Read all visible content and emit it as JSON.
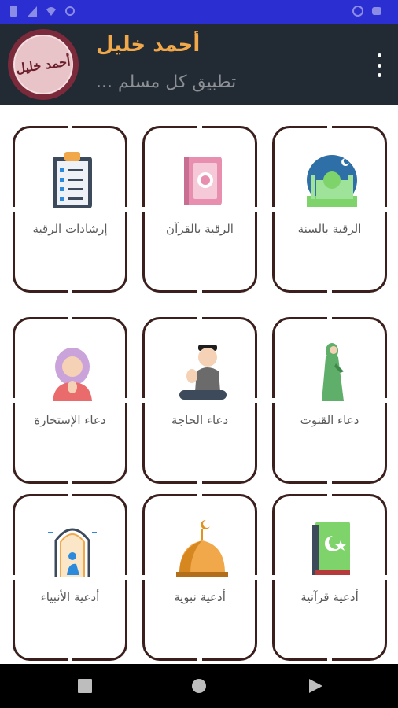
{
  "header": {
    "logo_text": "أحمد خليل",
    "title": "أحمد خليل",
    "subtitle": "تطبيق كل مسلم ..."
  },
  "grid": {
    "items": [
      {
        "label": "إرشادات الرقية",
        "icon": "clipboard-checklist-icon"
      },
      {
        "label": "الرقية بالقرآن",
        "icon": "quran-book-icon"
      },
      {
        "label": "الرقية بالسنة",
        "icon": "mosque-icon"
      },
      {
        "label": "دعاء الإستخارة",
        "icon": "praying-girl-icon"
      },
      {
        "label": "دعاء الحاجة",
        "icon": "praying-boy-icon"
      },
      {
        "label": "دعاء القنوت",
        "icon": "praying-woman-icon"
      },
      {
        "label": "أدعية الأنبياء",
        "icon": "prophets-prayer-icon"
      },
      {
        "label": "أدعية نبوية",
        "icon": "mosque-dome-icon"
      },
      {
        "label": "أدعية قرآنية",
        "icon": "green-quran-icon"
      }
    ]
  },
  "colors": {
    "status_bar": "#2b2ed1",
    "app_bar": "#222a33",
    "title_accent": "#f1a84b",
    "card_border": "#3a1f1d"
  }
}
